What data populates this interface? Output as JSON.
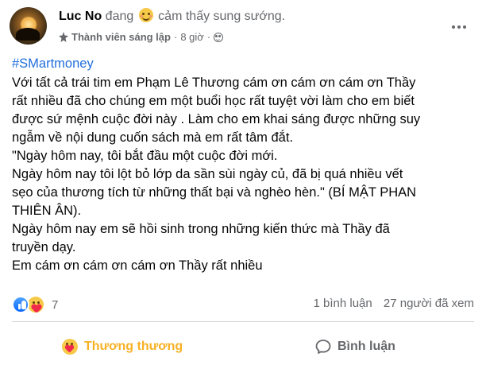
{
  "header": {
    "name": "Luc No",
    "feeling_prefix": "đang",
    "feeling_icon": "smiling-emoji-icon",
    "feeling_text": "cảm thấy sung sướng.",
    "role": "Thành viên sáng lập",
    "separator": "·",
    "time": "8 giờ",
    "privacy_icon": "group-privacy-icon",
    "more_icon": "more-horizontal-icon"
  },
  "post": {
    "hashtag": "#SMartmoney",
    "paragraphs": [
      "Với tất cả trái tim em Phạm Lê Thương cám ơn cám ơn cám ơn Thầy\nrất nhiều đã cho chúng em một buổi học rất tuyệt vời làm cho em biết\nđược sứ mệnh cuộc đời này . Làm cho em khai sáng được những suy\nngẫm  về nội dung cuốn sách mà em rất tâm đắt.",
      "\"Ngày hôm nay, tôi bắt đầu một cuộc đời mới.",
      "Ngày hôm nay tôi lột bỏ lớp da sần sùi ngày củ, đã bị quá nhiều vết\nsẹo của thương tích từ những thất bại và nghèo hèn.\" (BÍ MẬT PHAN\nTHIÊN ÂN).",
      "Ngày hôm nay em sẽ hồi sinh trong những kiến thức mà Thầy đã\ntruyền dạy.",
      "Em cám ơn cám ơn cám ơn Thầy rất nhiều"
    ]
  },
  "reactions": {
    "icons": [
      "like-icon",
      "care-icon"
    ],
    "count": "7",
    "comments": "1 bình luận",
    "views": "27 người đã xem"
  },
  "actions": {
    "care_label": "Thương thương",
    "comment_label": "Bình luận"
  },
  "colors": {
    "link": "#216fdb",
    "care": "#f7b125",
    "secondary_text": "#65676b",
    "like": "#0866ff"
  }
}
